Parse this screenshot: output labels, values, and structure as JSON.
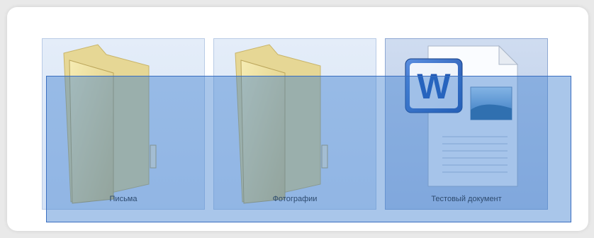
{
  "explorer": {
    "items": [
      {
        "label": "Письма",
        "type": "folder",
        "icon": "folder-icon"
      },
      {
        "label": "Фотографии",
        "type": "folder",
        "icon": "folder-icon"
      },
      {
        "label": "Тестовый документ",
        "type": "word-document",
        "icon": "word-document-icon"
      }
    ],
    "selection": {
      "mode": "rubber-band",
      "selected_count": 3
    }
  },
  "colors": {
    "selection_fill": "#3376cc",
    "item_bg": "#dce7f6",
    "folder": "#eee3a1"
  }
}
